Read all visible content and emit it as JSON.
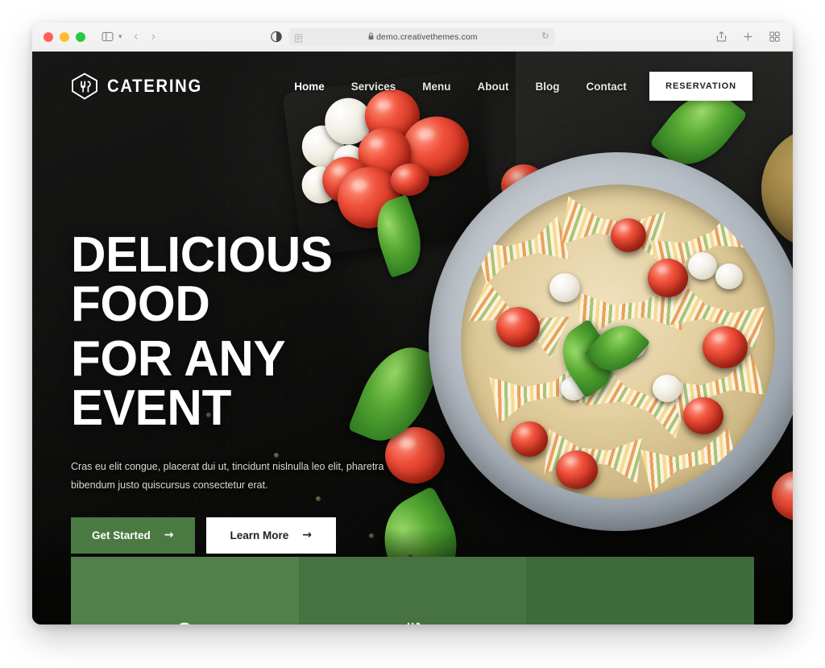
{
  "browser": {
    "traffic_lights": [
      "close",
      "minimize",
      "maximize"
    ],
    "sidebar_icon": "sidebar-icon",
    "tab_overview_chevron": "chevron-down-icon",
    "back_arrow": "‹",
    "forward_arrow": "›",
    "privacy_icon": "privacy-report-icon",
    "reader_icon": "reader-view-icon",
    "lock_glyph": "🔒",
    "url": "demo.creativethemes.com",
    "reload_glyph": "↻",
    "share_icon": "share-icon",
    "new_tab_icon": "plus-icon",
    "tab_grid_icon": "tab-overview-icon"
  },
  "site": {
    "logo": {
      "mark": "house-cutlery-icon",
      "text": "CATERING"
    },
    "nav": [
      {
        "label": "Home",
        "active": true
      },
      {
        "label": "Services",
        "active": false
      },
      {
        "label": "Menu",
        "active": false
      },
      {
        "label": "About",
        "active": false
      },
      {
        "label": "Blog",
        "active": false
      },
      {
        "label": "Contact",
        "active": false
      }
    ],
    "reservation_label": "RESERVATION"
  },
  "hero": {
    "headline_line_1": "DELICIOUS FOOD",
    "headline_line_2": "FOR ANY EVENT",
    "description": "Cras eu elit congue, placerat dui ut, tincidunt nislnulla leo elit, pharetra bibendum justo quiscursus consectetur erat.",
    "primary_button": {
      "label": "Get Started",
      "arrow": "→"
    },
    "secondary_button": {
      "label": "Learn More",
      "arrow": "→"
    }
  },
  "features": [
    {
      "icon": "chef-hat-icon"
    },
    {
      "icon": "cutlery-icon"
    },
    {
      "icon": "bell-icon"
    }
  ],
  "colors": {
    "brand_green": "#4a7a42",
    "feature_green_1": "#51804a",
    "feature_green_2": "#477242",
    "feature_green_3": "#3f6a3b",
    "page_background": "#0d0d0c",
    "button_white": "#ffffff"
  }
}
